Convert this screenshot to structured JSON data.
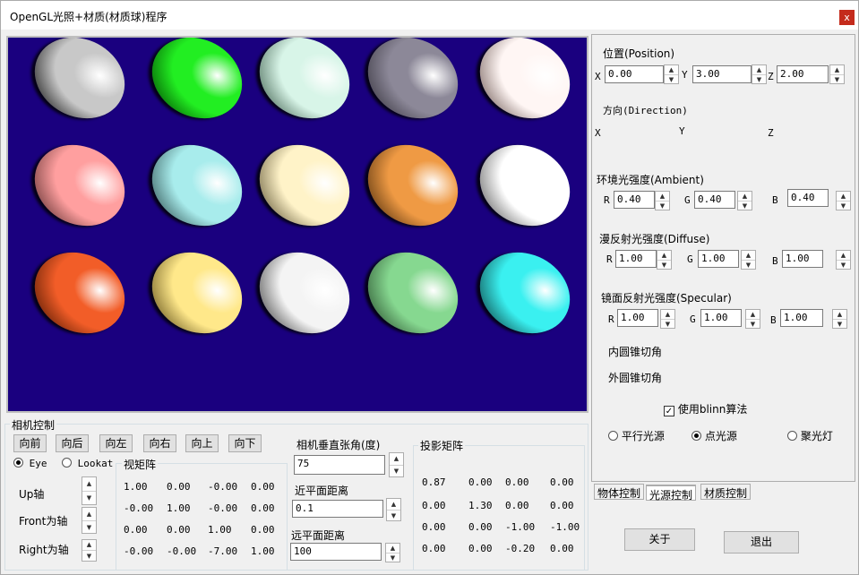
{
  "window": {
    "title": "OpenGL光照+材质(材质球)程序",
    "close_label": "x"
  },
  "spheres": [
    {
      "color": "#c8c8c8",
      "shadow": "#0a0a0a"
    },
    {
      "color": "#22ee22",
      "shadow": "#004400"
    },
    {
      "color": "#d8f5e8",
      "shadow": "#3a5a48"
    },
    {
      "color": "#8c8898",
      "shadow": "#33303a"
    },
    {
      "color": "#fff6f4",
      "shadow": "#6a5550"
    },
    {
      "color": "#ff9f9f",
      "shadow": "#552a2a"
    },
    {
      "color": "#a8ecec",
      "shadow": "#2a4a4a"
    },
    {
      "color": "#fff3c8",
      "shadow": "#5a5030"
    },
    {
      "color": "#ef9a44",
      "shadow": "#4a2a0a"
    },
    {
      "color": "#ffffff",
      "shadow": "#555555"
    },
    {
      "color": "#f25d28",
      "shadow": "#4a1500"
    },
    {
      "color": "#ffe88a",
      "shadow": "#5a4a15"
    },
    {
      "color": "#f4f4f4",
      "shadow": "#3a3a3a"
    },
    {
      "color": "#86d890",
      "shadow": "#264a2a"
    },
    {
      "color": "#3af0f0",
      "shadow": "#0a3a3a"
    }
  ],
  "light_panel": {
    "position_title": "位置(Position)",
    "pos_x_label": "X",
    "pos_x": "0.00",
    "pos_y_label": "Y",
    "pos_y": "3.00",
    "pos_z_label": "Z",
    "pos_z": "2.00",
    "direction_title": "方向(Direction)",
    "dir_x_label": "X",
    "dir_y_label": "Y",
    "dir_z_label": "Z",
    "ambient_title": "环境光强度(Ambient)",
    "amb_r_label": "R",
    "amb_r": "0.40",
    "amb_g_label": "G",
    "amb_g": "0.40",
    "amb_b_label": "B",
    "amb_b": "0.40",
    "diffuse_title": "漫反射光强度(Diffuse)",
    "dif_r_label": "R",
    "dif_r": "1.00",
    "dif_g_label": "G",
    "dif_g": "1.00",
    "dif_b_label": "B",
    "dif_b": "1.00",
    "specular_title": "镜面反射光强度(Specular)",
    "spe_r_label": "R",
    "spe_r": "1.00",
    "spe_g_label": "G",
    "spe_g": "1.00",
    "spe_b_label": "B",
    "spe_b": "1.00",
    "inner_cone": "内圆锥切角",
    "outer_cone": "外圆锥切角",
    "blinn_label": "使用blinn算法",
    "blinn_checked": true,
    "light_types": [
      {
        "label": "平行光源",
        "selected": false
      },
      {
        "label": "点光源",
        "selected": true
      },
      {
        "label": "聚光灯",
        "selected": false
      }
    ]
  },
  "tabs": [
    {
      "label": "物体控制",
      "active": false
    },
    {
      "label": "光源控制",
      "active": true
    },
    {
      "label": "材质控制",
      "active": false
    }
  ],
  "about_label": "关于",
  "exit_label": "退出",
  "camera": {
    "group_title": "相机控制",
    "buttons": [
      "向前",
      "向后",
      "向左",
      "向右",
      "向上",
      "向下"
    ],
    "eye_label": "Eye",
    "lookat_label": "Lookat",
    "mode": "Eye",
    "up_label": "Up轴",
    "front_label": "Front为轴",
    "right_label": "Right为轴",
    "view_matrix_title": "视矩阵",
    "view_matrix": [
      [
        "1.00",
        "0.00",
        "-0.00",
        "0.00"
      ],
      [
        "-0.00",
        "1.00",
        "-0.00",
        "0.00"
      ],
      [
        "0.00",
        "0.00",
        "1.00",
        "0.00"
      ],
      [
        "-0.00",
        "-0.00",
        "-7.00",
        "1.00"
      ]
    ],
    "fov_label": "相机垂直张角(度)",
    "fov_value": "75",
    "near_label": "近平面距离",
    "near_value": "0.1",
    "far_label": "远平面距离",
    "far_value": "100",
    "proj_matrix_title": "投影矩阵",
    "proj_matrix": [
      [
        "0.87",
        "0.00",
        "0.00",
        "0.00"
      ],
      [
        "0.00",
        "1.30",
        "0.00",
        "0.00"
      ],
      [
        "0.00",
        "0.00",
        "-1.00",
        "-1.00"
      ],
      [
        "0.00",
        "0.00",
        "-0.20",
        "0.00"
      ]
    ]
  },
  "colors": {
    "canvas_bg": "#1a007f",
    "close_red": "#c42b1c"
  }
}
